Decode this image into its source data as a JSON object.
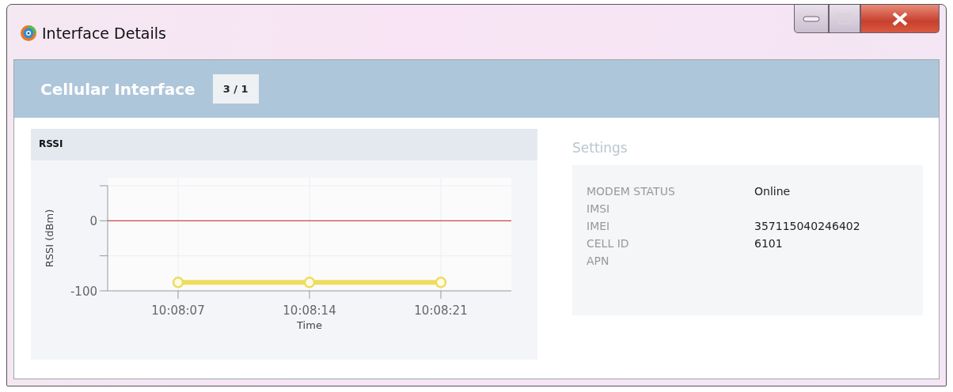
{
  "window": {
    "title": "Interface Details"
  },
  "header": {
    "title": "Cellular Interface",
    "badge": "3 / 1"
  },
  "rssi_panel": {
    "chart_data": {
      "type": "line",
      "title": "RSSI",
      "xlabel": "Time",
      "ylabel": "RSSI (dBm)",
      "categories": [
        "10:08:07",
        "10:08:14",
        "10:08:21"
      ],
      "series": [
        {
          "color": "#eedc5c",
          "marker": "circle",
          "values": [
            -88,
            -88,
            -88
          ]
        }
      ],
      "ylim": [
        -100,
        50
      ],
      "yticks": [
        -100,
        0
      ],
      "grid": true,
      "ref_lines": [
        {
          "axis": "y",
          "value": 0,
          "color": "#c84a4a"
        }
      ]
    }
  },
  "settings": {
    "title": "Settings",
    "rows": [
      {
        "label": "MODEM STATUS",
        "value": "Online"
      },
      {
        "label": "IMSI"
      },
      {
        "label": "IMEI",
        "value": "357115040246402"
      },
      {
        "label": "CELL ID",
        "value": "6101"
      },
      {
        "label": "APN"
      }
    ]
  }
}
